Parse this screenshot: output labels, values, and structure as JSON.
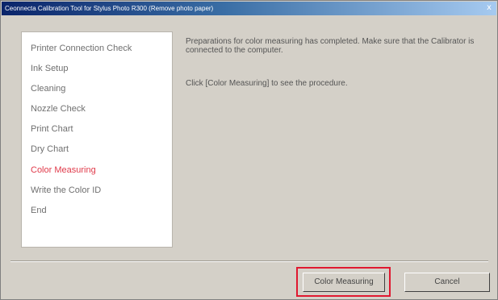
{
  "window": {
    "title": "Ceonnecta Calibration Tool for Stylus Photo R300 (Remove photo paper)",
    "close_glyph": "x"
  },
  "steps": [
    {
      "label": "Printer Connection Check",
      "active": false
    },
    {
      "label": "Ink Setup",
      "active": false
    },
    {
      "label": "Cleaning",
      "active": false
    },
    {
      "label": "Nozzle Check",
      "active": false
    },
    {
      "label": "Print Chart",
      "active": false
    },
    {
      "label": "Dry Chart",
      "active": false
    },
    {
      "label": "Color Measuring",
      "active": true
    },
    {
      "label": "Write the Color ID",
      "active": false
    },
    {
      "label": "End",
      "active": false
    }
  ],
  "message": {
    "line1": "Preparations for color measuring has completed. Make sure that the Calibrator is connected to the computer.",
    "line2": "Click [Color Measuring] to see the procedure."
  },
  "buttons": {
    "primary": "Color Measuring",
    "cancel": "Cancel"
  },
  "colors": {
    "active_step": "#e03a4a",
    "highlight_box": "#e01830",
    "dialog_bg": "#d4d0c8"
  }
}
